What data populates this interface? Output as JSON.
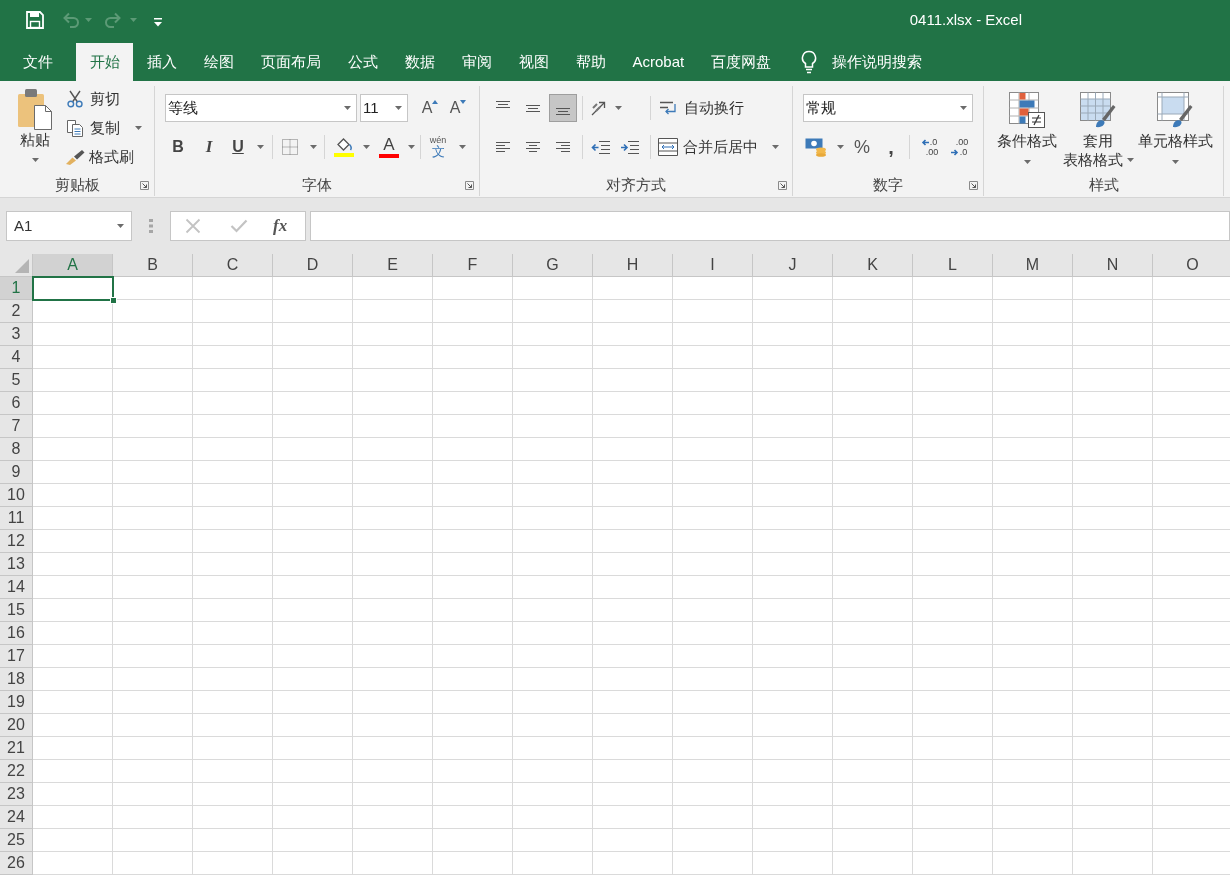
{
  "quick_access": [
    {
      "kind": "save",
      "disabled": false
    },
    {
      "kind": "undo",
      "disabled": true
    },
    {
      "kind": "redo",
      "disabled": true
    }
  ],
  "window": {
    "title": "0411.xlsx - Excel"
  },
  "tabs": [
    {
      "label": "文件",
      "selected": false
    },
    {
      "label": "开始",
      "selected": true
    },
    {
      "label": "插入",
      "selected": false
    },
    {
      "label": "绘图",
      "selected": false
    },
    {
      "label": "页面布局",
      "selected": false
    },
    {
      "label": "公式",
      "selected": false
    },
    {
      "label": "数据",
      "selected": false
    },
    {
      "label": "审阅",
      "selected": false
    },
    {
      "label": "视图",
      "selected": false
    },
    {
      "label": "帮助",
      "selected": false
    },
    {
      "label": "Acrobat",
      "selected": false
    },
    {
      "label": "百度网盘",
      "selected": false
    }
  ],
  "tell_me": {
    "label": "操作说明搜索"
  },
  "ribbon": {
    "clipboard": {
      "title": "剪贴板",
      "paste": "粘贴",
      "cut": "剪切",
      "copy": "复制",
      "format_painter": "格式刷"
    },
    "font": {
      "title": "字体",
      "font_name": "等线",
      "font_size": "11",
      "grow": "A",
      "shrink": "A",
      "bold": "B",
      "italic": "I",
      "underline": "U",
      "color_buttons": [
        {
          "kind": "fill",
          "color": "#ffff00"
        },
        {
          "kind": "text",
          "label": "A",
          "color": "#ff0000"
        }
      ],
      "phonetic": {
        "pinyin": "wén",
        "character": "文"
      }
    },
    "alignment": {
      "title": "对齐方式",
      "vertical": [
        {
          "kind": "top",
          "selected": false
        },
        {
          "kind": "middle",
          "selected": false
        },
        {
          "kind": "bottom",
          "selected": true
        }
      ],
      "horizontal": [
        {
          "kind": "left",
          "selected": false
        },
        {
          "kind": "center",
          "selected": false
        },
        {
          "kind": "right",
          "selected": false
        }
      ],
      "wrap_text": "自动换行",
      "merge_center": "合并后居中"
    },
    "number": {
      "title": "数字",
      "format": "常规",
      "percent": "%",
      "comma": ",",
      "increase_decimal": [
        ".0",
        ".00"
      ],
      "decrease_decimal": [
        ".00",
        ".0"
      ]
    },
    "styles": {
      "title": "样式",
      "items": [
        {
          "kind": "conditional",
          "lines": [
            "条件格式"
          ]
        },
        {
          "kind": "table",
          "lines": [
            "套用",
            "表格格式"
          ]
        },
        {
          "kind": "cell",
          "lines": [
            "单元格样式"
          ]
        }
      ]
    }
  },
  "formula_bar": {
    "name_box": "A1",
    "buttons": [
      {
        "kind": "cancel",
        "disabled": true
      },
      {
        "kind": "enter",
        "disabled": true
      }
    ],
    "insert_function": "fx"
  },
  "sheet": {
    "columns": [
      {
        "label": "A",
        "selected": true
      },
      {
        "label": "B",
        "selected": false
      },
      {
        "label": "C",
        "selected": false
      },
      {
        "label": "D",
        "selected": false
      },
      {
        "label": "E",
        "selected": false
      },
      {
        "label": "F",
        "selected": false
      },
      {
        "label": "G",
        "selected": false
      },
      {
        "label": "H",
        "selected": false
      },
      {
        "label": "I",
        "selected": false
      },
      {
        "label": "J",
        "selected": false
      },
      {
        "label": "K",
        "selected": false
      },
      {
        "label": "L",
        "selected": false
      },
      {
        "label": "M",
        "selected": false
      },
      {
        "label": "N",
        "selected": false
      },
      {
        "label": "O",
        "selected": false
      }
    ],
    "rows": [
      {
        "label": "1",
        "selected": true
      },
      {
        "label": "2",
        "selected": false
      },
      {
        "label": "3",
        "selected": false
      },
      {
        "label": "4",
        "selected": false
      },
      {
        "label": "5",
        "selected": false
      },
      {
        "label": "6",
        "selected": false
      },
      {
        "label": "7",
        "selected": false
      },
      {
        "label": "8",
        "selected": false
      },
      {
        "label": "9",
        "selected": false
      },
      {
        "label": "10",
        "selected": false
      },
      {
        "label": "11",
        "selected": false
      },
      {
        "label": "12",
        "selected": false
      },
      {
        "label": "13",
        "selected": false
      },
      {
        "label": "14",
        "selected": false
      },
      {
        "label": "15",
        "selected": false
      },
      {
        "label": "16",
        "selected": false
      },
      {
        "label": "17",
        "selected": false
      },
      {
        "label": "18",
        "selected": false
      },
      {
        "label": "19",
        "selected": false
      },
      {
        "label": "20",
        "selected": false
      },
      {
        "label": "21",
        "selected": false
      },
      {
        "label": "22",
        "selected": false
      },
      {
        "label": "23",
        "selected": false
      },
      {
        "label": "24",
        "selected": false
      },
      {
        "label": "25",
        "selected": false
      },
      {
        "label": "26",
        "selected": false
      }
    ]
  }
}
